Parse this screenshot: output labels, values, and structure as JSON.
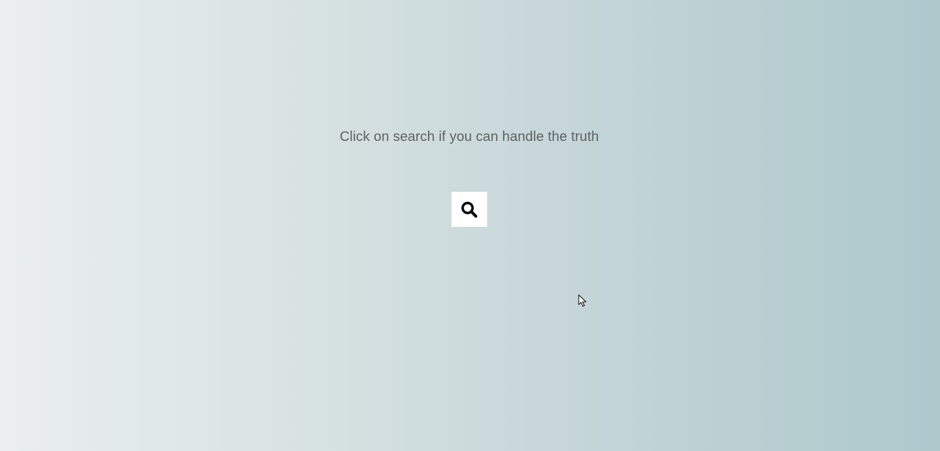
{
  "prompt": {
    "text": "Click on search if you can handle the truth"
  },
  "search_button": {
    "icon": "search-icon",
    "label": "Search"
  }
}
